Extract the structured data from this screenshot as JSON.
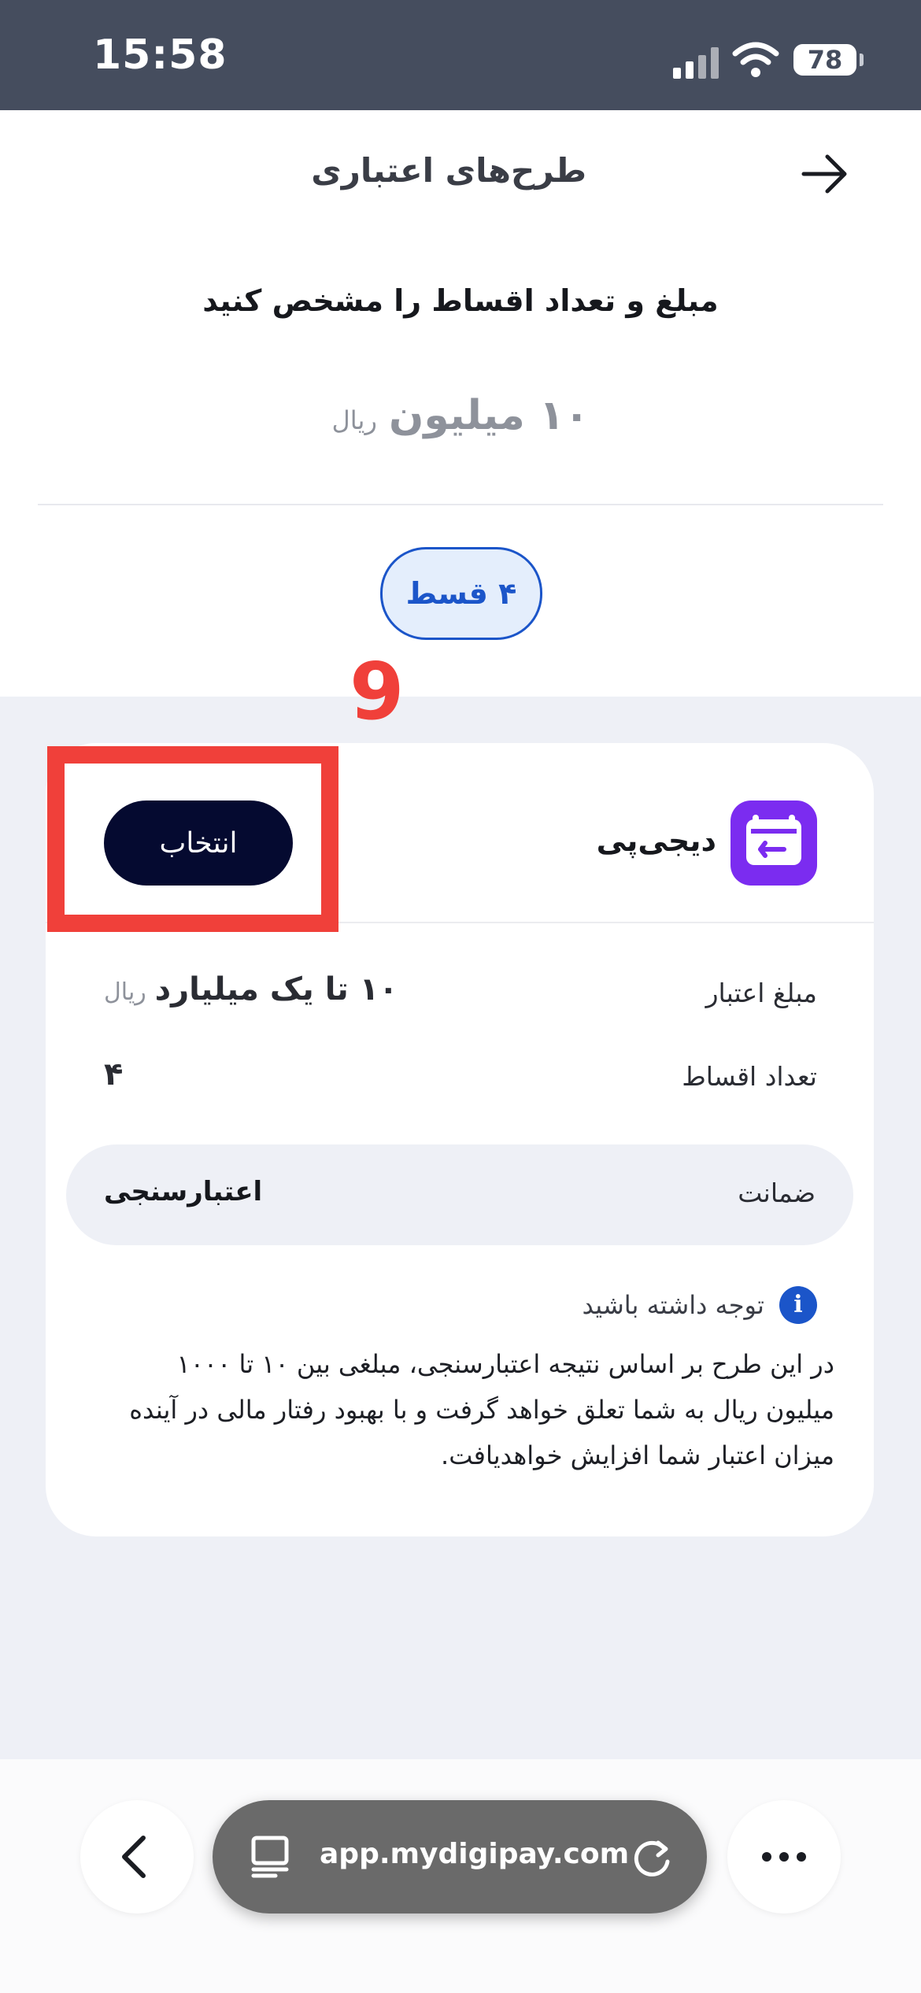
{
  "status_bar": {
    "time": "15:58",
    "battery": "78"
  },
  "header": {
    "title": "طرح‌های اعتباری"
  },
  "subtitle": "مبلغ و تعداد اقساط را مشخص کنید",
  "amount": {
    "value": "۱۰ میلیون",
    "unit": "ریال"
  },
  "installments_chip": "۴ قسط",
  "annotation": {
    "step": "9"
  },
  "plan_card": {
    "brand": "دیجی‌پی",
    "select_label": "انتخاب",
    "credit_label": "مبلغ اعتبار",
    "credit_value": "۱۰ تا یک میلیارد",
    "credit_unit": "ریال",
    "installments_label": "تعداد اقساط",
    "installments_value": "۴",
    "guarantee_label": "ضمانت",
    "guarantee_value": "اعتبارسنجی",
    "note_title": "توجه داشته باشید",
    "note_body": "در این طرح بر اساس نتیجه اعتبارسنجی، مبلغی بین ۱۰ تا ۱۰۰۰ میلیون ریال به شما تعلق خواهد گرفت و با بهبود رفتار مالی در آینده میزان اعتبار شما افزایش خواهدیافت."
  },
  "browser": {
    "url": "app.mydigipay.com"
  },
  "icons": [
    "back-arrow-icon",
    "wallet-logo-icon",
    "info-icon",
    "chevron-left-icon",
    "tabs-icon",
    "reload-icon",
    "more-icon"
  ],
  "colors": {
    "primary": "#1b55c9",
    "button": "#050a30",
    "brand": "#7b2cf0",
    "annotation": "#f0403a"
  }
}
